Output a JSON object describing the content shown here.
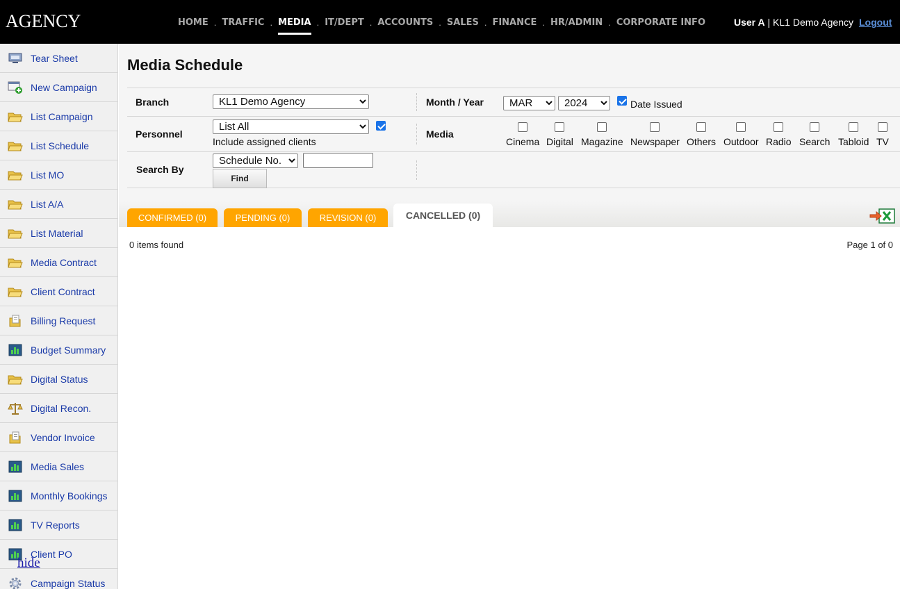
{
  "header": {
    "logo": "AGENCY",
    "nav": [
      "HOME",
      "TRAFFIC",
      "MEDIA",
      "IT/DEPT",
      "ACCOUNTS",
      "SALES",
      "FINANCE",
      "HR/ADMIN",
      "CORPORATE INFO"
    ],
    "nav_separator": ".",
    "active_nav": "MEDIA",
    "user_name": "User A",
    "user_agency": " | KL1 Demo Agency",
    "logout": "Logout"
  },
  "sidebar": {
    "items": [
      {
        "label": "Tear Sheet",
        "icon": "monitor-icon"
      },
      {
        "label": "New Campaign",
        "icon": "add-window-icon"
      },
      {
        "label": "List Campaign",
        "icon": "folder-open-icon"
      },
      {
        "label": "List Schedule",
        "icon": "folder-open-icon"
      },
      {
        "label": "List MO",
        "icon": "folder-open-icon"
      },
      {
        "label": "List A/A",
        "icon": "folder-open-icon"
      },
      {
        "label": "List Material",
        "icon": "folder-open-icon"
      },
      {
        "label": "Media Contract",
        "icon": "folder-open-icon"
      },
      {
        "label": "Client Contract",
        "icon": "folder-open-icon"
      },
      {
        "label": "Billing Request",
        "icon": "document-folder-icon"
      },
      {
        "label": "Budget Summary",
        "icon": "bar-chart-icon"
      },
      {
        "label": "Digital Status",
        "icon": "folder-open-icon"
      },
      {
        "label": "Digital Recon.",
        "icon": "scales-icon"
      },
      {
        "label": "Vendor Invoice",
        "icon": "document-folder-icon"
      },
      {
        "label": "Media Sales",
        "icon": "bar-chart-icon"
      },
      {
        "label": "Monthly Bookings",
        "icon": "bar-chart-icon"
      },
      {
        "label": "TV Reports",
        "icon": "bar-chart-icon"
      },
      {
        "label": "Client PO",
        "icon": "bar-chart-icon"
      },
      {
        "label": "Campaign Status",
        "icon": "gear-icon"
      }
    ],
    "hide_link": "hide"
  },
  "main": {
    "title": "Media Schedule",
    "filters": {
      "branch_label": "Branch",
      "branch_value": "KL1 Demo Agency",
      "month_year_label": "Month / Year",
      "month_value": "MAR",
      "year_value": "2024",
      "date_issued_label": "Date Issued",
      "date_issued_checked": true,
      "personnel_label": "Personnel",
      "personnel_value": "List All",
      "include_assigned_label": "Include assigned clients",
      "include_assigned_checked": true,
      "media_label": "Media",
      "media_options": [
        "Cinema",
        "Digital",
        "Magazine",
        "Newspaper",
        "Others",
        "Outdoor",
        "Radio",
        "Search",
        "Tabloid",
        "TV"
      ],
      "search_by_label": "Search By",
      "search_by_value": "Schedule No.",
      "search_value": "",
      "find_button": "Find"
    },
    "tabs": [
      {
        "label": "CONFIRMED (0)",
        "active": false
      },
      {
        "label": "PENDING (0)",
        "active": false
      },
      {
        "label": "REVISION (0)",
        "active": false
      },
      {
        "label": "CANCELLED (0)",
        "active": true
      }
    ],
    "items_found": "0 items found",
    "page_info": "Page 1 of 0"
  },
  "colors": {
    "topbar": "#000000",
    "tab_orange": "#ffa500",
    "link_blue": "#1a3aa8",
    "checkbox_blue": "#1a73e8"
  }
}
